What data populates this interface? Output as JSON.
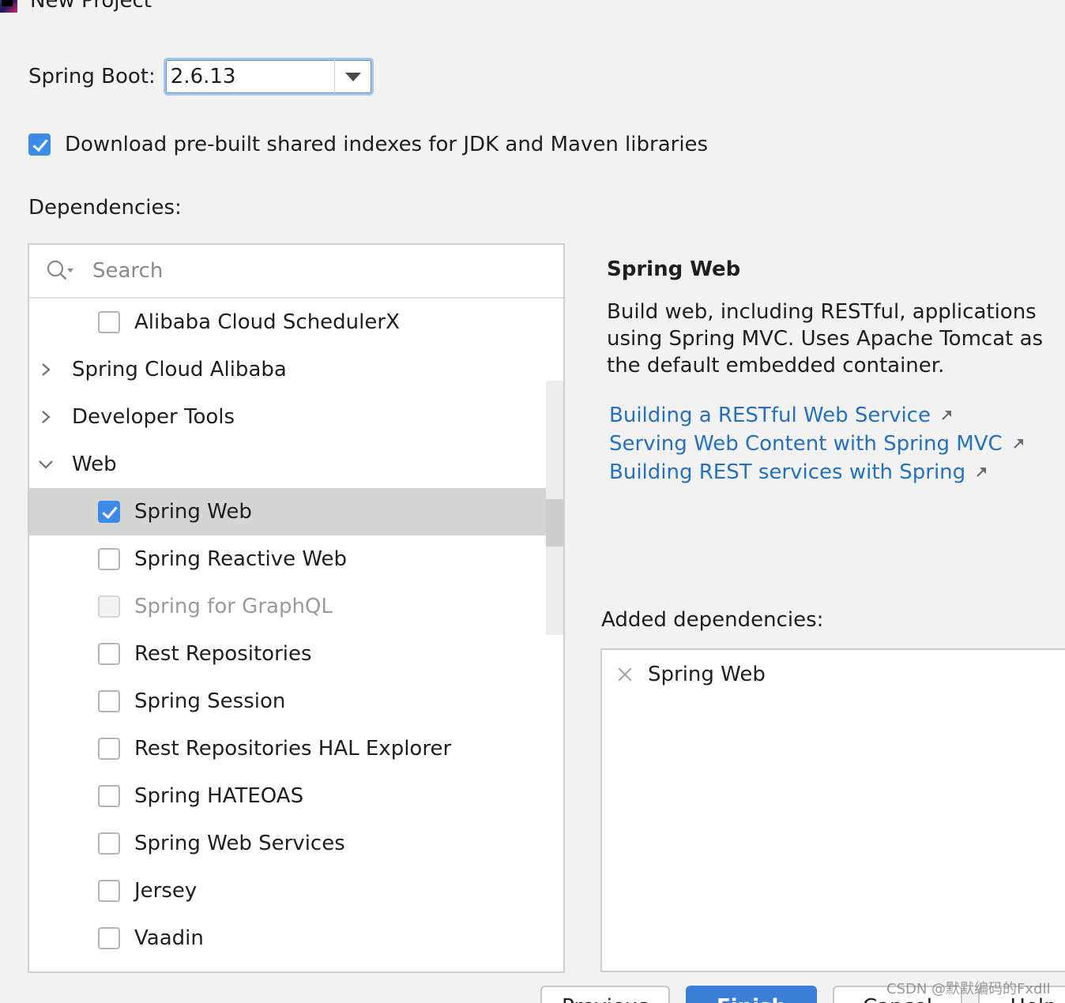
{
  "window": {
    "title": "New Project"
  },
  "spring_boot": {
    "label": "Spring Boot:",
    "selected_version": "2.6.13"
  },
  "download_indexes": {
    "label": "Download pre-built shared indexes for JDK and Maven libraries",
    "checked": true
  },
  "dependencies": {
    "label": "Dependencies:",
    "search_placeholder": "Search",
    "tree": [
      {
        "kind": "leaf",
        "label": "Alibaba Cloud SchedulerX",
        "checked": false
      },
      {
        "kind": "group",
        "label": "Spring Cloud Alibaba",
        "expanded": false
      },
      {
        "kind": "group",
        "label": "Developer Tools",
        "expanded": false
      },
      {
        "kind": "group",
        "label": "Web",
        "expanded": true
      },
      {
        "kind": "leaf",
        "label": "Spring Web",
        "checked": true,
        "selected": true
      },
      {
        "kind": "leaf",
        "label": "Spring Reactive Web",
        "checked": false
      },
      {
        "kind": "leaf",
        "label": "Spring for GraphQL",
        "checked": false,
        "disabled": true
      },
      {
        "kind": "leaf",
        "label": "Rest Repositories",
        "checked": false
      },
      {
        "kind": "leaf",
        "label": "Spring Session",
        "checked": false
      },
      {
        "kind": "leaf",
        "label": "Rest Repositories HAL Explorer",
        "checked": false
      },
      {
        "kind": "leaf",
        "label": "Spring HATEOAS",
        "checked": false
      },
      {
        "kind": "leaf",
        "label": "Spring Web Services",
        "checked": false
      },
      {
        "kind": "leaf",
        "label": "Jersey",
        "checked": false
      },
      {
        "kind": "leaf",
        "label": "Vaadin",
        "checked": false
      }
    ]
  },
  "detail": {
    "title": "Spring Web",
    "description": "Build web, including RESTful, applications using Spring MVC. Uses Apache Tomcat as the default embedded container.",
    "links": [
      "Building a RESTful Web Service",
      "Serving Web Content with Spring MVC",
      "Building REST services with Spring"
    ]
  },
  "added": {
    "label": "Added dependencies:",
    "items": [
      "Spring Web"
    ]
  },
  "buttons": {
    "previous": "Previous",
    "finish": "Finish",
    "cancel": "Cancel",
    "help": "Help"
  },
  "watermark": "CSDN @默默编码的Fxdll",
  "colors": {
    "accent": "#3c8ce7",
    "link": "#2470c2",
    "selection": "#d5d5d5",
    "background": "#f2f2f2"
  }
}
